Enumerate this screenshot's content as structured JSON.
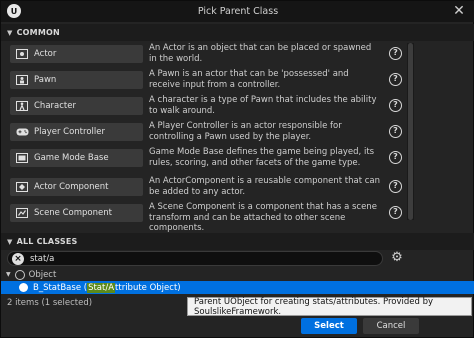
{
  "window": {
    "title": "Pick Parent Class",
    "logo_text": "U",
    "close_glyph": "✕"
  },
  "common": {
    "header": "COMMON",
    "items": [
      {
        "label": "Actor",
        "icon": "actor-icon",
        "description": "An Actor is an object that can be placed or spawned in the world."
      },
      {
        "label": "Pawn",
        "icon": "pawn-icon",
        "description": "A Pawn is an actor that can be 'possessed' and receive input from a controller."
      },
      {
        "label": "Character",
        "icon": "character-icon",
        "description": "A character is a type of Pawn that includes the ability to walk around."
      },
      {
        "label": "Player Controller",
        "icon": "gamepad-icon",
        "description": "A Player Controller is an actor responsible for controlling a Pawn used by the player."
      },
      {
        "label": "Game Mode Base",
        "icon": "game-mode-icon",
        "description": "Game Mode Base defines the game being played, its rules, scoring, and other facets of the game type."
      },
      {
        "label": "Actor Component",
        "icon": "actor-component-icon",
        "description": "An ActorComponent is a reusable component that can be added to any actor."
      },
      {
        "label": "Scene Component",
        "icon": "scene-component-icon",
        "description": "A Scene Component is a component that has a scene transform and can be attached to other scene components."
      }
    ],
    "help_glyph": "?"
  },
  "all_classes": {
    "header": "ALL CLASSES",
    "search_value": "stat/a",
    "tree": {
      "root": "Object",
      "selected_item": {
        "prefix": "B_StatBase (",
        "highlight": "Stat/A",
        "suffix": "ttribute Object)"
      }
    }
  },
  "tooltip": "Parent UObject for creating stats/attributes. Provided by SoulslikeFramework.",
  "status": "2 items (1 selected)",
  "buttons": {
    "select": "Select",
    "cancel": "Cancel"
  },
  "colors": {
    "accent": "#0070e0",
    "match_highlight": "#5c8a1c",
    "background": "#242424"
  }
}
